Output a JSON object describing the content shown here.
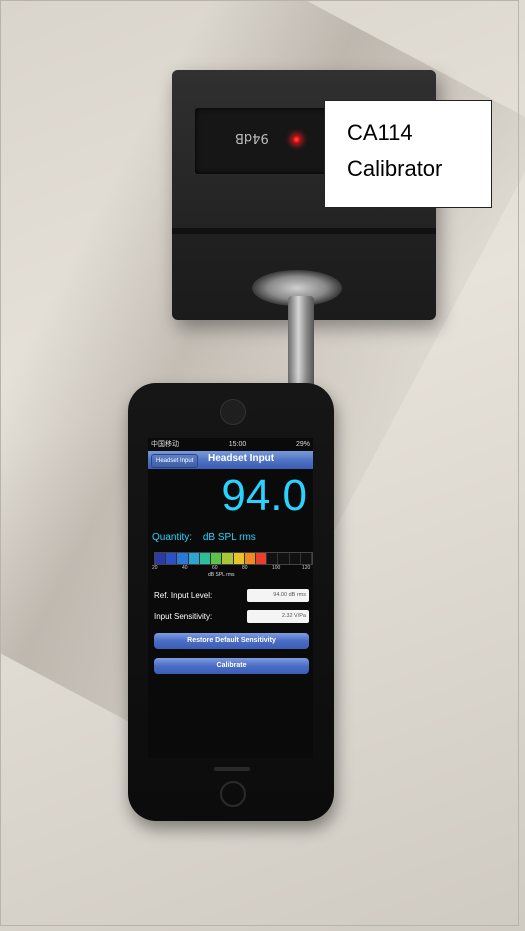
{
  "label": {
    "line1": "CA114",
    "line2": "Calibrator"
  },
  "calibrator_display": {
    "text": "94dB"
  },
  "phone": {
    "status": {
      "carrier": "中国移动",
      "time": "15:00",
      "battery": "29%"
    },
    "nav": {
      "back_label": "Headset Input",
      "title": "Headset Input"
    },
    "reading": {
      "value": "94.0"
    },
    "quantity": {
      "label": "Quantity:",
      "unit": "dB SPL rms"
    },
    "meter": {
      "ticks": [
        "20",
        "40",
        "60",
        "80",
        "100",
        "120"
      ],
      "unit": "dB SPL rms",
      "level_fraction": 0.74,
      "colors": [
        "#2a3ba8",
        "#2a52c4",
        "#2b78d8",
        "#2aa6d0",
        "#2cbd9a",
        "#5ac34a",
        "#a8c83a",
        "#e7c42a",
        "#f08a22",
        "#e8402a",
        "#111111",
        "#111111",
        "#111111",
        "#111111"
      ]
    },
    "fields": [
      {
        "label": "Ref. Input Level:",
        "value": "94.00 dB rms"
      },
      {
        "label": "Input Sensitivity:",
        "value": "2.32 V/Pa"
      }
    ],
    "buttons": {
      "restore": "Restore Default Sensitivity",
      "calibrate": "Calibrate"
    }
  }
}
